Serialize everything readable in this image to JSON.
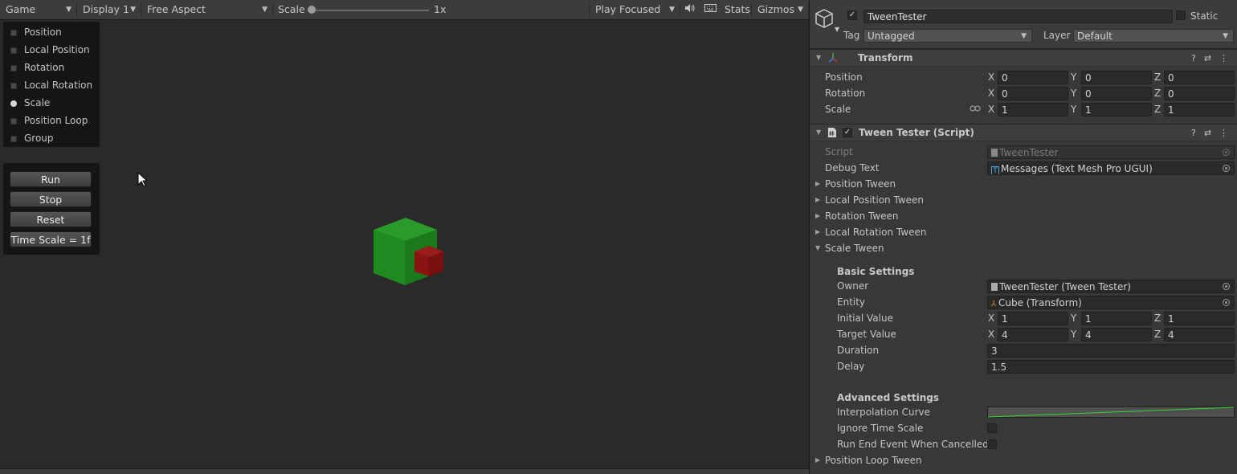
{
  "game_toolbar": {
    "view": "Game",
    "display": "Display 1",
    "aspect": "Free Aspect",
    "scale_label": "Scale",
    "scale_value": "1x",
    "play_mode": "Play Focused",
    "stats": "Stats",
    "gizmos": "Gizmos"
  },
  "radio_options": [
    "Position",
    "Local Position",
    "Rotation",
    "Local Rotation",
    "Scale",
    "Position Loop",
    "Group"
  ],
  "selected_option": "Scale",
  "buttons": {
    "run": "Run",
    "stop": "Stop",
    "reset": "Reset",
    "time_scale": "Time Scale = 1f"
  },
  "scene": {
    "green_cube_color": "#1d8a1d",
    "red_cube_color": "#8a1212"
  },
  "inspector": {
    "object_name": "TweenTester",
    "static_label": "Static",
    "tag_label": "Tag",
    "tag_value": "Untagged",
    "layer_label": "Layer",
    "layer_value": "Default",
    "transform": {
      "title": "Transform",
      "position_label": "Position",
      "rotation_label": "Rotation",
      "scale_label": "Scale",
      "position": {
        "x": "0",
        "y": "0",
        "z": "0"
      },
      "rotation": {
        "x": "0",
        "y": "0",
        "z": "0"
      },
      "scale": {
        "x": "1",
        "y": "1",
        "z": "1"
      }
    },
    "script": {
      "title": "Tween Tester (Script)",
      "script_label": "Script",
      "script_value": "TweenTester",
      "debug_label": "Debug Text",
      "debug_value": "Messages (Text Mesh Pro UGUI)",
      "foldouts": [
        "Position Tween",
        "Local Position Tween",
        "Rotation Tween",
        "Local Rotation Tween"
      ],
      "scale_tween_label": "Scale Tween",
      "basic_settings": "Basic Settings",
      "owner_label": "Owner",
      "owner_value": "TweenTester (Tween Tester)",
      "entity_label": "Entity",
      "entity_value": "Cube (Transform)",
      "initial_label": "Initial Value",
      "initial": {
        "x": "1",
        "y": "1",
        "z": "1"
      },
      "target_label": "Target Value",
      "target": {
        "x": "4",
        "y": "4",
        "z": "4"
      },
      "duration_label": "Duration",
      "duration_value": "3",
      "delay_label": "Delay",
      "delay_value": "1.5",
      "advanced_settings": "Advanced Settings",
      "curve_label": "Interpolation Curve",
      "ignore_ts_label": "Ignore Time Scale",
      "run_end_label": "Run End Event When Cancelled",
      "position_loop_label": "Position Loop Tween"
    }
  },
  "axis_labels": {
    "x": "X",
    "y": "Y",
    "z": "Z"
  }
}
